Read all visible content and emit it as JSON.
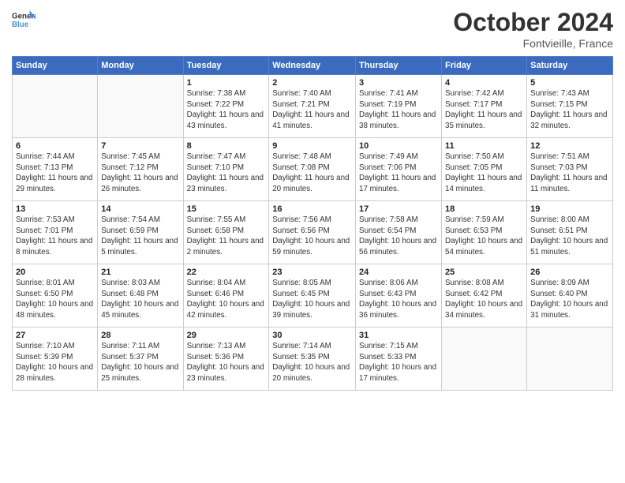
{
  "header": {
    "logo_line1": "General",
    "logo_line2": "Blue",
    "month": "October 2024",
    "location": "Fontvieille, France"
  },
  "days_of_week": [
    "Sunday",
    "Monday",
    "Tuesday",
    "Wednesday",
    "Thursday",
    "Friday",
    "Saturday"
  ],
  "weeks": [
    [
      {
        "day": "",
        "info": ""
      },
      {
        "day": "",
        "info": ""
      },
      {
        "day": "1",
        "info": "Sunrise: 7:38 AM\nSunset: 7:22 PM\nDaylight: 11 hours and 43 minutes."
      },
      {
        "day": "2",
        "info": "Sunrise: 7:40 AM\nSunset: 7:21 PM\nDaylight: 11 hours and 41 minutes."
      },
      {
        "day": "3",
        "info": "Sunrise: 7:41 AM\nSunset: 7:19 PM\nDaylight: 11 hours and 38 minutes."
      },
      {
        "day": "4",
        "info": "Sunrise: 7:42 AM\nSunset: 7:17 PM\nDaylight: 11 hours and 35 minutes."
      },
      {
        "day": "5",
        "info": "Sunrise: 7:43 AM\nSunset: 7:15 PM\nDaylight: 11 hours and 32 minutes."
      }
    ],
    [
      {
        "day": "6",
        "info": "Sunrise: 7:44 AM\nSunset: 7:13 PM\nDaylight: 11 hours and 29 minutes."
      },
      {
        "day": "7",
        "info": "Sunrise: 7:45 AM\nSunset: 7:12 PM\nDaylight: 11 hours and 26 minutes."
      },
      {
        "day": "8",
        "info": "Sunrise: 7:47 AM\nSunset: 7:10 PM\nDaylight: 11 hours and 23 minutes."
      },
      {
        "day": "9",
        "info": "Sunrise: 7:48 AM\nSunset: 7:08 PM\nDaylight: 11 hours and 20 minutes."
      },
      {
        "day": "10",
        "info": "Sunrise: 7:49 AM\nSunset: 7:06 PM\nDaylight: 11 hours and 17 minutes."
      },
      {
        "day": "11",
        "info": "Sunrise: 7:50 AM\nSunset: 7:05 PM\nDaylight: 11 hours and 14 minutes."
      },
      {
        "day": "12",
        "info": "Sunrise: 7:51 AM\nSunset: 7:03 PM\nDaylight: 11 hours and 11 minutes."
      }
    ],
    [
      {
        "day": "13",
        "info": "Sunrise: 7:53 AM\nSunset: 7:01 PM\nDaylight: 11 hours and 8 minutes."
      },
      {
        "day": "14",
        "info": "Sunrise: 7:54 AM\nSunset: 6:59 PM\nDaylight: 11 hours and 5 minutes."
      },
      {
        "day": "15",
        "info": "Sunrise: 7:55 AM\nSunset: 6:58 PM\nDaylight: 11 hours and 2 minutes."
      },
      {
        "day": "16",
        "info": "Sunrise: 7:56 AM\nSunset: 6:56 PM\nDaylight: 10 hours and 59 minutes."
      },
      {
        "day": "17",
        "info": "Sunrise: 7:58 AM\nSunset: 6:54 PM\nDaylight: 10 hours and 56 minutes."
      },
      {
        "day": "18",
        "info": "Sunrise: 7:59 AM\nSunset: 6:53 PM\nDaylight: 10 hours and 54 minutes."
      },
      {
        "day": "19",
        "info": "Sunrise: 8:00 AM\nSunset: 6:51 PM\nDaylight: 10 hours and 51 minutes."
      }
    ],
    [
      {
        "day": "20",
        "info": "Sunrise: 8:01 AM\nSunset: 6:50 PM\nDaylight: 10 hours and 48 minutes."
      },
      {
        "day": "21",
        "info": "Sunrise: 8:03 AM\nSunset: 6:48 PM\nDaylight: 10 hours and 45 minutes."
      },
      {
        "day": "22",
        "info": "Sunrise: 8:04 AM\nSunset: 6:46 PM\nDaylight: 10 hours and 42 minutes."
      },
      {
        "day": "23",
        "info": "Sunrise: 8:05 AM\nSunset: 6:45 PM\nDaylight: 10 hours and 39 minutes."
      },
      {
        "day": "24",
        "info": "Sunrise: 8:06 AM\nSunset: 6:43 PM\nDaylight: 10 hours and 36 minutes."
      },
      {
        "day": "25",
        "info": "Sunrise: 8:08 AM\nSunset: 6:42 PM\nDaylight: 10 hours and 34 minutes."
      },
      {
        "day": "26",
        "info": "Sunrise: 8:09 AM\nSunset: 6:40 PM\nDaylight: 10 hours and 31 minutes."
      }
    ],
    [
      {
        "day": "27",
        "info": "Sunrise: 7:10 AM\nSunset: 5:39 PM\nDaylight: 10 hours and 28 minutes."
      },
      {
        "day": "28",
        "info": "Sunrise: 7:11 AM\nSunset: 5:37 PM\nDaylight: 10 hours and 25 minutes."
      },
      {
        "day": "29",
        "info": "Sunrise: 7:13 AM\nSunset: 5:36 PM\nDaylight: 10 hours and 23 minutes."
      },
      {
        "day": "30",
        "info": "Sunrise: 7:14 AM\nSunset: 5:35 PM\nDaylight: 10 hours and 20 minutes."
      },
      {
        "day": "31",
        "info": "Sunrise: 7:15 AM\nSunset: 5:33 PM\nDaylight: 10 hours and 17 minutes."
      },
      {
        "day": "",
        "info": ""
      },
      {
        "day": "",
        "info": ""
      }
    ]
  ]
}
